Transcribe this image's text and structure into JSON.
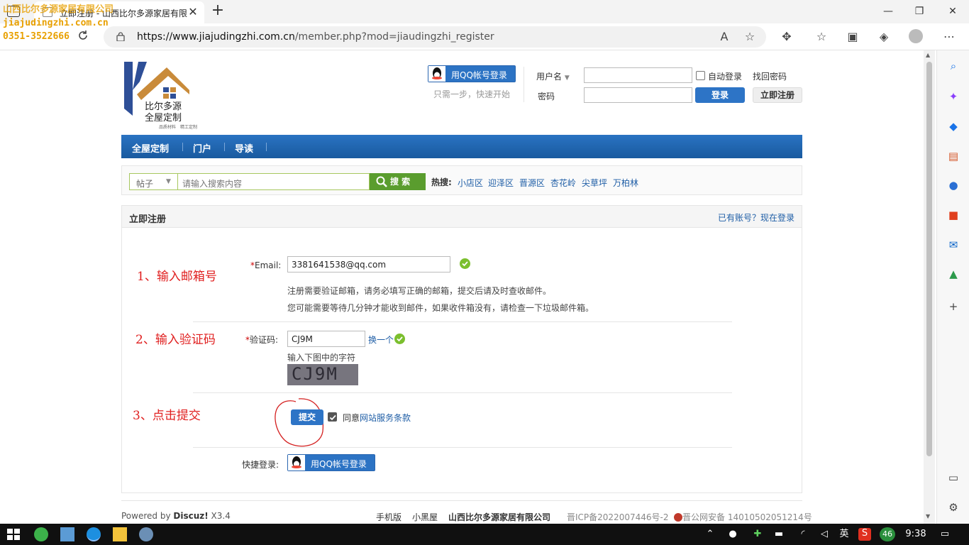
{
  "browser": {
    "tab_title": "立即注册 - 山西比尔多源家居有限",
    "tab_close": "✕",
    "new_tab": "+",
    "url_host": "https://www.jiajudingzhi.com.cn",
    "url_path": "/member.php?mod=jiaudingzhi_register",
    "window": {
      "minimize": "—",
      "maximize": "❐",
      "close": "✕"
    }
  },
  "watermark": {
    "line1": "山西比尔多源家居有限公司",
    "line2": "jiajudingzhi.com.cn",
    "line3": "0351-3522666"
  },
  "logo": {
    "name_line1": "比尔多源",
    "name_line2": "全屋定制",
    "tagline": "品质材料　精工定制"
  },
  "header": {
    "qq_login_label": "用QQ帐号登录",
    "slogan": "只需一步，快速开始",
    "username_label": "用户名",
    "password_label": "密码",
    "auto_login_label": "自动登录",
    "find_password": "找回密码",
    "login_button": "登录",
    "register_button": "立即注册"
  },
  "nav": {
    "items": [
      {
        "label": "全屋定制"
      },
      {
        "label": "门户"
      },
      {
        "label": "导读"
      }
    ]
  },
  "search": {
    "type_label": "帖子",
    "placeholder": "请输入搜索内容",
    "button": "搜 索",
    "hot_label": "热搜:",
    "hot_items": [
      "小店区",
      "迎泽区",
      "晋源区",
      "杏花岭",
      "尖草坪",
      "万柏林"
    ]
  },
  "register": {
    "title": "立即注册",
    "login_link": "已有账号？现在登录",
    "annotation1": "1、输入邮箱号",
    "annotation2": "2、输入验证码",
    "annotation3": "3、点击提交",
    "email_label": "Email:",
    "email_value": "3381641538@qq.com",
    "email_hint1": "注册需要验证邮箱，请务必填写正确的邮箱，提交后请及时查收邮件。",
    "email_hint2": "您可能需要等待几分钟才能收到邮件，如果收件箱没有，请检查一下垃圾邮件箱。",
    "captcha_label": "验证码:",
    "captcha_value": "CJ9M",
    "captcha_refresh": "换一个",
    "captcha_hint": "输入下图中的字符",
    "captcha_image_text": "CJ9M",
    "required_mark": "*",
    "submit_button": "提交",
    "agree_text": "同意",
    "terms_link": "网站服务条款",
    "quick_login_label": "快捷登录:",
    "quick_qq_label": "用QQ帐号登录"
  },
  "footer": {
    "powered_prefix": "Powered by ",
    "powered_brand": "Discuz!",
    "powered_version": " X3.4",
    "links": [
      "手机版",
      "小黑屋",
      "山西比尔多源家居有限公司"
    ],
    "icp": "晋ICP备2022007446号-2",
    "police": "晋公网安备 14010502051214号"
  },
  "taskbar": {
    "ime": "英",
    "badge": "46",
    "time": "9:38"
  },
  "colors": {
    "nav_blue": "#1b5fa8",
    "link_blue": "#1f5ea6",
    "annotation_red": "#e02020",
    "search_green": "#5a9d2e",
    "watermark_orange": "#e8a000"
  }
}
